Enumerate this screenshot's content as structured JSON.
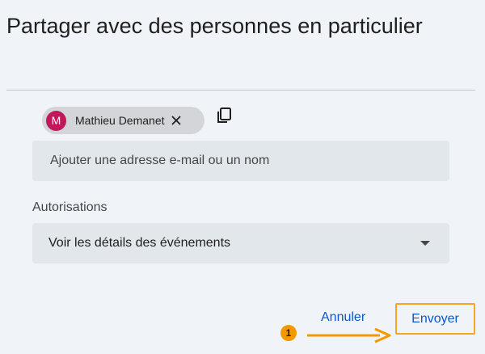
{
  "dialog": {
    "title": "Partager avec des personnes en particulier",
    "recipient_chip": {
      "initial": "M",
      "name": "Mathieu Demanet",
      "avatar_color": "#c2185b"
    },
    "email_input": {
      "placeholder": "Ajouter une adresse e-mail ou un nom",
      "value": ""
    },
    "permissions": {
      "label": "Autorisations",
      "selected": "Voir les détails des événements"
    },
    "actions": {
      "cancel_label": "Annuler",
      "send_label": "Envoyer"
    }
  },
  "annotation": {
    "step_number": "1",
    "color": "#f5a623"
  },
  "colors": {
    "accent": "#0b57d0",
    "background": "#f0f4f9"
  }
}
